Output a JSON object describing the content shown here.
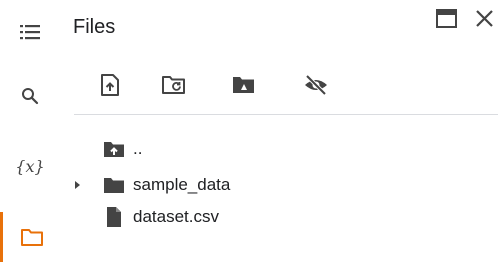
{
  "title": "Files",
  "rail": {
    "variables_glyph": "{x}"
  },
  "tree": {
    "parent_label": "..",
    "items": [
      {
        "label": "sample_data",
        "type": "folder"
      },
      {
        "label": "dataset.csv",
        "type": "file"
      }
    ]
  },
  "colors": {
    "accent": "#e8710a",
    "icon": "#444444",
    "divider": "#dadce0"
  }
}
